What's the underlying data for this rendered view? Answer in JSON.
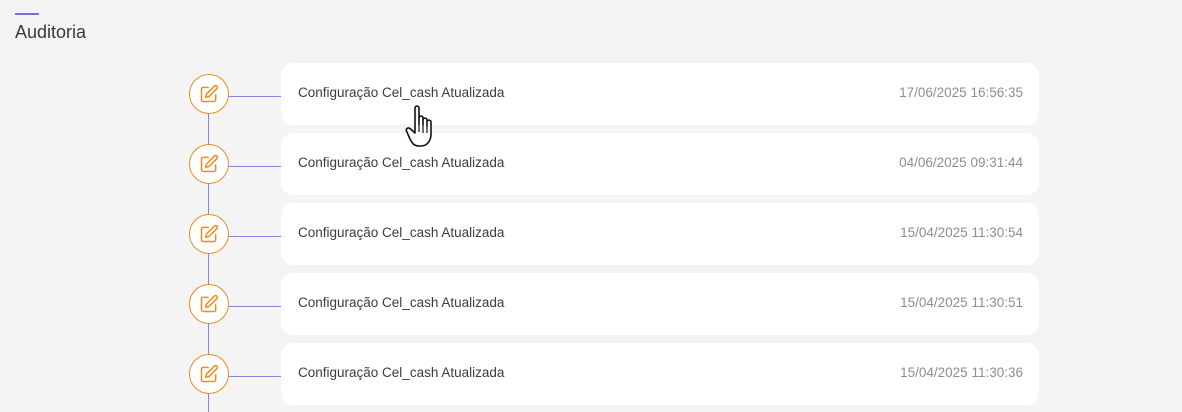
{
  "page": {
    "title": "Auditoria"
  },
  "audit": {
    "entries": [
      {
        "text": "Configuração Cel_cash Atualizada",
        "date": "17/06/2025 16:56:35"
      },
      {
        "text": "Configuração Cel_cash Atualizada",
        "date": "04/06/2025 09:31:44"
      },
      {
        "text": "Configuração Cel_cash Atualizada",
        "date": "15/04/2025 11:30:54"
      },
      {
        "text": "Configuração Cel_cash Atualizada",
        "date": "15/04/2025 11:30:51"
      },
      {
        "text": "Configuração Cel_cash Atualizada",
        "date": "15/04/2025 11:30:36"
      }
    ]
  },
  "colors": {
    "accent": "#7a6fd8",
    "icon": "#f08a1e",
    "timeline": "#8a80e0",
    "background": "#f4f4f4"
  },
  "icons": {
    "entry_icon": "edit-icon",
    "cursor": "hand-pointer-cursor"
  }
}
